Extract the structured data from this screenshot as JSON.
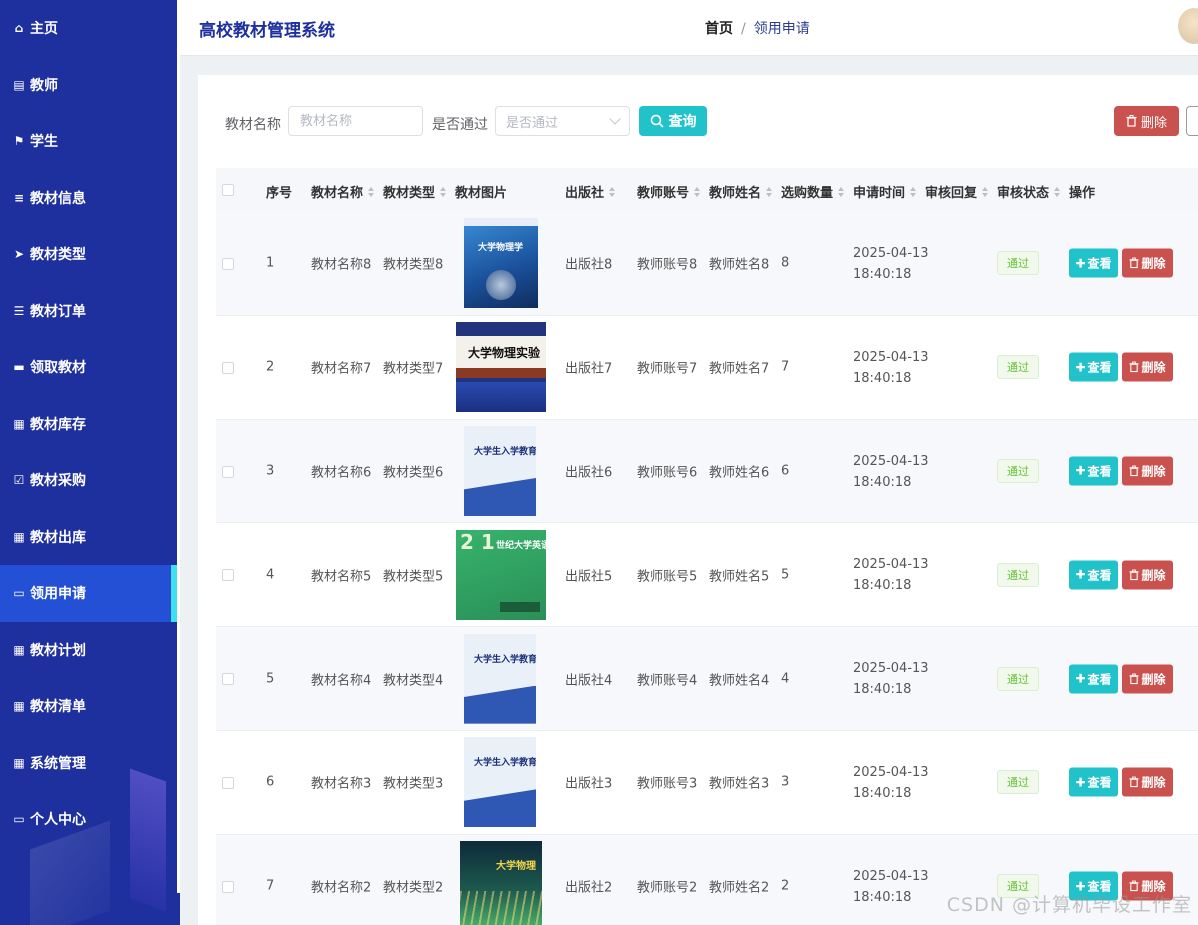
{
  "sidebar": {
    "items": [
      {
        "label": "主页",
        "icon": "home-icon",
        "glyph": "⌂"
      },
      {
        "label": "教师",
        "icon": "clipboard-icon",
        "glyph": "▤"
      },
      {
        "label": "学生",
        "icon": "flag-icon",
        "glyph": "⚑"
      },
      {
        "label": "教材信息",
        "icon": "list-icon",
        "glyph": "≡"
      },
      {
        "label": "教材类型",
        "icon": "send-icon",
        "glyph": "➤"
      },
      {
        "label": "教材订单",
        "icon": "sliders-icon",
        "glyph": "☰"
      },
      {
        "label": "领取教材",
        "icon": "chat-icon",
        "glyph": "▬"
      },
      {
        "label": "教材库存",
        "icon": "grid-icon",
        "glyph": "▦"
      },
      {
        "label": "教材采购",
        "icon": "clipboard-check-icon",
        "glyph": "☑"
      },
      {
        "label": "教材出库",
        "icon": "grid-icon",
        "glyph": "▦"
      },
      {
        "label": "领用申请",
        "icon": "ticket-icon",
        "glyph": "▭"
      },
      {
        "label": "教材计划",
        "icon": "grid-icon",
        "glyph": "▦"
      },
      {
        "label": "教材清单",
        "icon": "grid-icon",
        "glyph": "▦"
      },
      {
        "label": "系统管理",
        "icon": "grid-icon",
        "glyph": "▦"
      },
      {
        "label": "个人中心",
        "icon": "card-icon",
        "glyph": "▭"
      }
    ],
    "active_index": 10
  },
  "header": {
    "title": "高校教材管理系统",
    "breadcrumb_home": "首页",
    "breadcrumb_sep": "/",
    "breadcrumb_current": "领用申请"
  },
  "filter": {
    "name_label": "教材名称",
    "name_placeholder": "教材名称",
    "pass_label": "是否通过",
    "pass_placeholder": "是否通过",
    "query_label": "查询",
    "delete_label": "删除"
  },
  "table": {
    "headers": [
      "序号",
      "教材名称",
      "教材类型",
      "教材图片",
      "出版社",
      "教师账号",
      "教师姓名",
      "选购数量",
      "申请时间",
      "审核回复",
      "审核状态",
      "操作"
    ],
    "view_label": "查看",
    "delete_label": "删除",
    "rows": [
      {
        "no": "1",
        "name": "教材名称8",
        "type": "教材类型8",
        "publisher": "出版社8",
        "account": "教师账号8",
        "teacher": "教师姓名8",
        "qty": "8",
        "date": "2025-04-13",
        "time": "18:40:18",
        "status": "通过",
        "cover_title": "大学物理学",
        "cover_style": "blue"
      },
      {
        "no": "2",
        "name": "教材名称7",
        "type": "教材类型7",
        "publisher": "出版社7",
        "account": "教师账号7",
        "teacher": "教师姓名7",
        "qty": "7",
        "date": "2025-04-13",
        "time": "18:40:18",
        "status": "通过",
        "cover_title": "大学物理实验",
        "cover_style": "lab"
      },
      {
        "no": "3",
        "name": "教材名称6",
        "type": "教材类型6",
        "publisher": "出版社6",
        "account": "教师账号6",
        "teacher": "教师姓名6",
        "qty": "6",
        "date": "2025-04-13",
        "time": "18:40:18",
        "status": "通过",
        "cover_title": "大学生入学教育",
        "cover_style": "edu"
      },
      {
        "no": "4",
        "name": "教材名称5",
        "type": "教材类型5",
        "publisher": "出版社5",
        "account": "教师账号5",
        "teacher": "教师姓名5",
        "qty": "5",
        "date": "2025-04-13",
        "time": "18:40:18",
        "status": "通过",
        "cover_title": "世纪大学英语",
        "cover_style": "green"
      },
      {
        "no": "5",
        "name": "教材名称4",
        "type": "教材类型4",
        "publisher": "出版社4",
        "account": "教师账号4",
        "teacher": "教师姓名4",
        "qty": "4",
        "date": "2025-04-13",
        "time": "18:40:18",
        "status": "通过",
        "cover_title": "大学生入学教育",
        "cover_style": "edu"
      },
      {
        "no": "6",
        "name": "教材名称3",
        "type": "教材类型3",
        "publisher": "出版社3",
        "account": "教师账号3",
        "teacher": "教师姓名3",
        "qty": "3",
        "date": "2025-04-13",
        "time": "18:40:18",
        "status": "通过",
        "cover_title": "大学生入学教育",
        "cover_style": "edu"
      },
      {
        "no": "7",
        "name": "教材名称2",
        "type": "教材类型2",
        "publisher": "出版社2",
        "account": "教师账号2",
        "teacher": "教师姓名2",
        "qty": "2",
        "date": "2025-04-13",
        "time": "18:40:18",
        "status": "通过",
        "cover_title": "大学物理",
        "cover_style": "dark"
      }
    ]
  },
  "watermark": "CSDN @计算机毕设工作室",
  "colors": {
    "sidebar": "#1e2f9e",
    "active": "#2450d6",
    "accent": "#22c2cb",
    "danger": "#c9524f",
    "success": "#67c23a"
  }
}
